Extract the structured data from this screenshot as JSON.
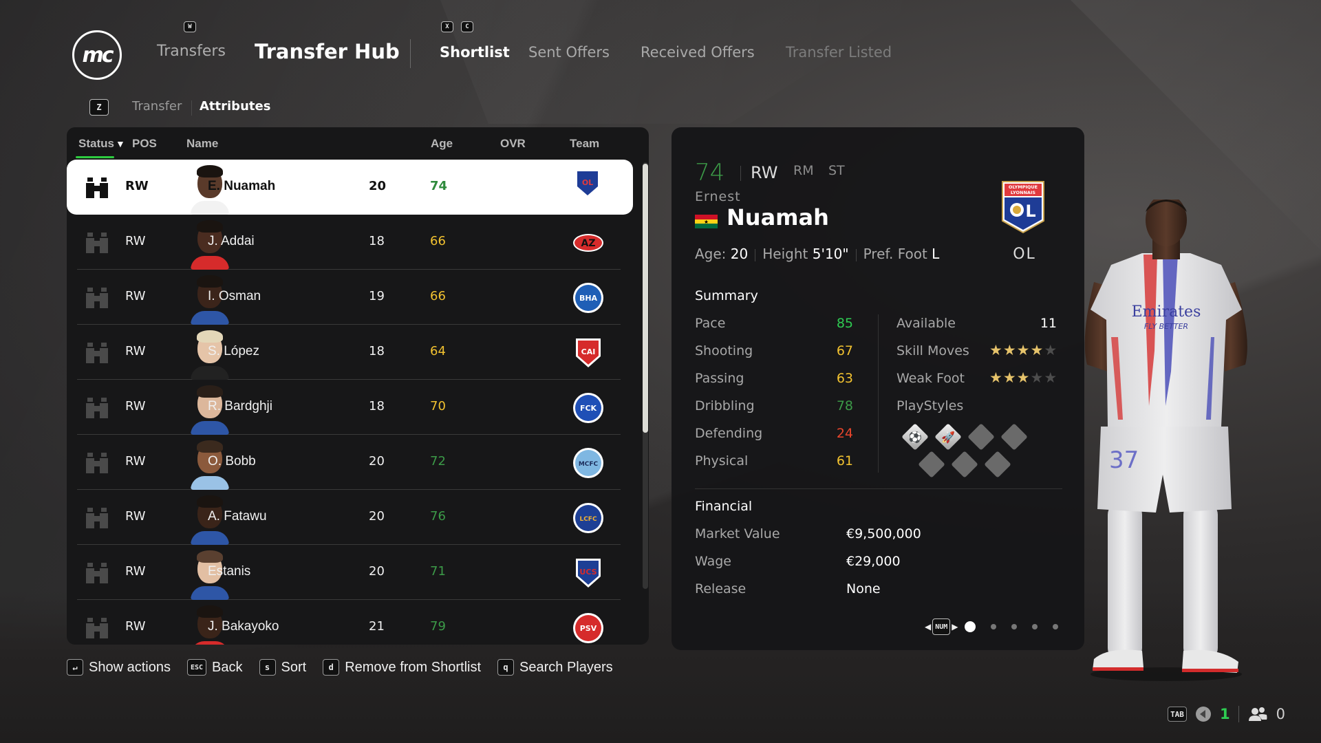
{
  "nav": {
    "logo_text": "mc",
    "transfers_key": "W",
    "transfers_label": "Transfers",
    "title": "Transfer Hub",
    "tab_keys": [
      "X",
      "C"
    ],
    "tabs": [
      {
        "label": "Shortlist",
        "state": "active"
      },
      {
        "label": "Sent Offers",
        "state": "normal"
      },
      {
        "label": "Received Offers",
        "state": "normal"
      },
      {
        "label": "Transfer Listed",
        "state": "disabled"
      }
    ]
  },
  "subnav": {
    "key": "Z",
    "items": [
      {
        "label": "Transfer",
        "active": false
      },
      {
        "label": "Attributes",
        "active": true
      }
    ]
  },
  "table": {
    "columns": {
      "status": "Status",
      "sort_icon": "▼",
      "pos": "POS",
      "name": "Name",
      "age": "Age",
      "ovr": "OVR",
      "team": "Team"
    },
    "rows": [
      {
        "pos": "RW",
        "name": "E. Nuamah",
        "age": "20",
        "ovr": "74",
        "team": "Olympique Lyonnais",
        "selected": true
      },
      {
        "pos": "RW",
        "name": "J. Addai",
        "age": "18",
        "ovr": "66",
        "team": "AZ Alkmaar",
        "selected": false
      },
      {
        "pos": "RW",
        "name": "I. Osman",
        "age": "19",
        "ovr": "66",
        "team": "Brighton & Hove Albion",
        "selected": false
      },
      {
        "pos": "RW",
        "name": "S. López",
        "age": "18",
        "ovr": "64",
        "team": "Independiente",
        "selected": false
      },
      {
        "pos": "RW",
        "name": "R. Bardghji",
        "age": "18",
        "ovr": "70",
        "team": "FC København",
        "selected": false
      },
      {
        "pos": "RW",
        "name": "O. Bobb",
        "age": "20",
        "ovr": "72",
        "team": "Manchester City",
        "selected": false
      },
      {
        "pos": "RW",
        "name": "A. Fatawu",
        "age": "20",
        "ovr": "76",
        "team": "Leicester City",
        "selected": false
      },
      {
        "pos": "RW",
        "name": "Estanis",
        "age": "20",
        "ovr": "71",
        "team": "Sampdoria",
        "selected": false
      },
      {
        "pos": "RW",
        "name": "J. Bakayoko",
        "age": "21",
        "ovr": "79",
        "team": "PSV",
        "selected": false
      }
    ],
    "scroll_fraction_visible": 0.63
  },
  "footer": [
    {
      "key": "↵",
      "label": "Show actions"
    },
    {
      "key": "ESC",
      "label": "Back"
    },
    {
      "key": "s",
      "label": "Sort"
    },
    {
      "key": "d",
      "label": "Remove from Shortlist"
    },
    {
      "key": "q",
      "label": "Search Players"
    }
  ],
  "detail": {
    "ovr": "74",
    "position": "RW",
    "alt_positions": [
      "RM",
      "ST"
    ],
    "first_name": "Ernest",
    "last_name": "Nuamah",
    "nationality": "Ghana",
    "age_label": "Age:",
    "age": "20",
    "height_label": "Height",
    "height": "5'10\"",
    "foot_label": "Pref. Foot",
    "foot": "L",
    "team_crest_top": "OLYMPIQUE LYONNAIS",
    "team_short": "OL",
    "summary_title": "Summary",
    "stats": [
      {
        "label": "Pace",
        "value": "85",
        "color": "#2ecc52"
      },
      {
        "label": "Shooting",
        "value": "67",
        "color": "#f2c230"
      },
      {
        "label": "Passing",
        "value": "63",
        "color": "#f2c230"
      },
      {
        "label": "Dribbling",
        "value": "78",
        "color": "#3c9b48"
      },
      {
        "label": "Defending",
        "value": "24",
        "color": "#e8452c"
      },
      {
        "label": "Physical",
        "value": "61",
        "color": "#f2c230"
      }
    ],
    "available_label": "Available",
    "available": "11",
    "skill_moves_label": "Skill Moves",
    "skill_moves": 4,
    "weak_foot_label": "Weak Foot",
    "weak_foot": 3,
    "star_max": 5,
    "playstyles_label": "PlayStyles",
    "playstyles": [
      {
        "name": "Finesse Shot",
        "glyph": "⚽",
        "active": true
      },
      {
        "name": "Rapid",
        "glyph": "🚀",
        "active": true
      },
      {
        "name": "",
        "active": false
      },
      {
        "name": "",
        "active": false
      },
      {
        "name": "",
        "active": false
      },
      {
        "name": "",
        "active": false
      },
      {
        "name": "",
        "active": false
      }
    ],
    "financial_title": "Financial",
    "financial": [
      {
        "label": "Market Value",
        "value": "€9,500,000"
      },
      {
        "label": "Wage",
        "value": "€29,000"
      },
      {
        "label": "Release",
        "value": "None"
      }
    ],
    "pager": {
      "key": "NUM",
      "pages": 5,
      "current": 1
    }
  },
  "status": {
    "tab_key": "TAB",
    "count_green": "1",
    "users": "0"
  },
  "colors": {
    "ovr_high": "#3c9b48",
    "ovr_mid": "#f2c230",
    "accent_green": "#2ecc40"
  }
}
